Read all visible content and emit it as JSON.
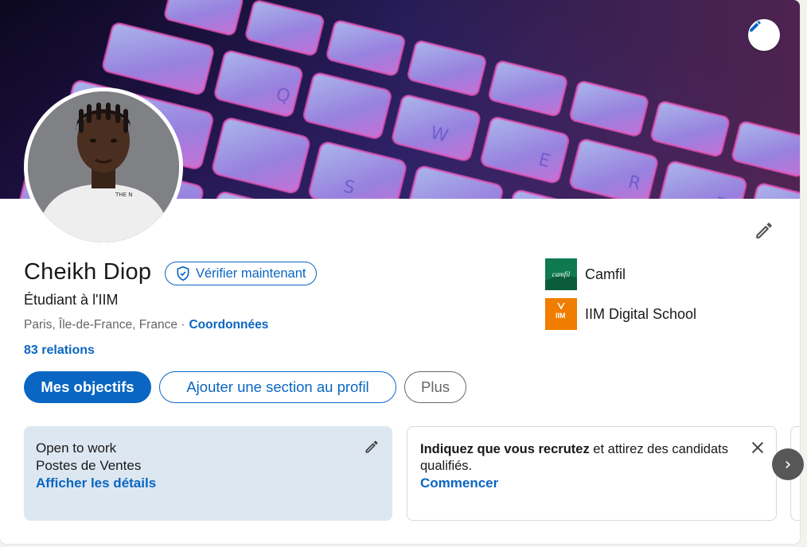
{
  "profile": {
    "name": "Cheikh Diop",
    "verify_label": "Vérifier maintenant",
    "headline": "Étudiant à l'IIM",
    "location": "Paris, Île-de-France, France ·",
    "contact_link": "Coordonnées",
    "connections": "83 relations"
  },
  "organizations": [
    {
      "name": "Camfil",
      "logo_text": "camfil",
      "color": "#0f7a4f"
    },
    {
      "name": "IIM Digital School",
      "logo_text": "IIM",
      "color": "#f07d00"
    }
  ],
  "actions": {
    "primary": "Mes objectifs",
    "add_section": "Ajouter une section au profil",
    "more": "Plus"
  },
  "open_to_work": {
    "title": "Open to work",
    "subtitle": "Postes de Ventes",
    "link": "Afficher les détails"
  },
  "hiring": {
    "text_bold": "Indiquez que vous recrutez",
    "text_rest": " et attirez des candidats qualifiés.",
    "link": "Commencer"
  },
  "carousel": {
    "next_glyph": "›"
  },
  "colors": {
    "accent": "#0a66c2",
    "open_to_work_bg": "#dde7f1"
  },
  "icons": [
    "pencil-icon",
    "shield-check-icon",
    "close-icon",
    "chevron-right-icon"
  ]
}
